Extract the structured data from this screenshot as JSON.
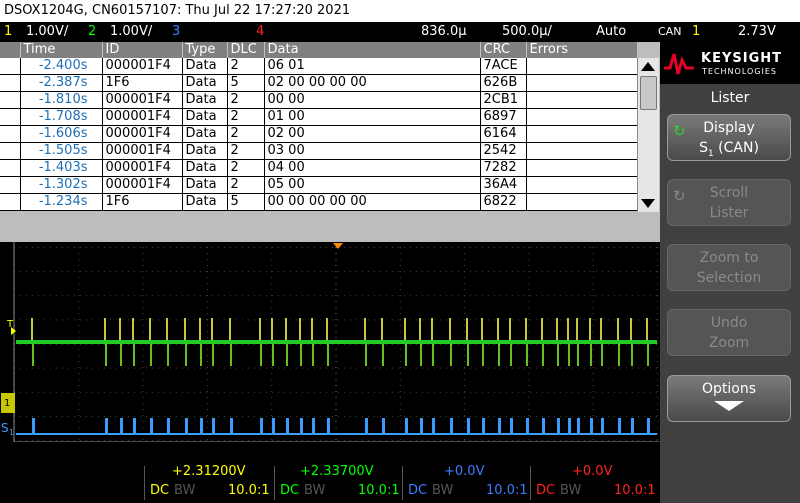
{
  "title": "DSOX1204G, CN60157107: Thu Jul 22 17:27:20 2021",
  "channels": {
    "ch1": {
      "num": "1",
      "scale": "1.00V/",
      "color": "#ffff00"
    },
    "ch2": {
      "num": "2",
      "scale": "1.00V/",
      "color": "#00ff00"
    },
    "ch3": {
      "num": "3",
      "color": "#3b7bff"
    },
    "ch4": {
      "num": "4",
      "color": "#ff2020"
    }
  },
  "timebase": {
    "delay": "836.0µ",
    "scale": "500.0µ/",
    "mode": "Auto"
  },
  "trigger": {
    "type": "CAN",
    "channel": "1",
    "level": "2.73V"
  },
  "lister": {
    "columns": [
      "Time",
      "ID",
      "Type",
      "DLC",
      "Data",
      "CRC",
      "Errors"
    ],
    "rows": [
      {
        "time": "-2.400s",
        "id": "000001F4",
        "type": "Data",
        "dlc": "2",
        "data": "06  01",
        "crc": "7ACE",
        "errors": ""
      },
      {
        "time": "-2.387s",
        "id": "1F6",
        "type": "Data",
        "dlc": "5",
        "data": "02  00  00  00  00",
        "crc": "626B",
        "errors": ""
      },
      {
        "time": "-1.810s",
        "id": "000001F4",
        "type": "Data",
        "dlc": "2",
        "data": "00  00",
        "crc": "2CB1",
        "errors": ""
      },
      {
        "time": "-1.708s",
        "id": "000001F4",
        "type": "Data",
        "dlc": "2",
        "data": "01  00",
        "crc": "6897",
        "errors": ""
      },
      {
        "time": "-1.606s",
        "id": "000001F4",
        "type": "Data",
        "dlc": "2",
        "data": "02  00",
        "crc": "6164",
        "errors": ""
      },
      {
        "time": "-1.505s",
        "id": "000001F4",
        "type": "Data",
        "dlc": "2",
        "data": "03  00",
        "crc": "2542",
        "errors": ""
      },
      {
        "time": "-1.403s",
        "id": "000001F4",
        "type": "Data",
        "dlc": "2",
        "data": "04  00",
        "crc": "7282",
        "errors": ""
      },
      {
        "time": "-1.302s",
        "id": "000001F4",
        "type": "Data",
        "dlc": "2",
        "data": "05  00",
        "crc": "36A4",
        "errors": ""
      },
      {
        "time": "-1.234s",
        "id": "1F6",
        "type": "Data",
        "dlc": "5",
        "data": "00  00  00  00  00",
        "crc": "6822",
        "errors": ""
      }
    ]
  },
  "waveform": {
    "trigger_marker": "T",
    "serial_label": "S",
    "serial_sub": "1",
    "ground_label": "1"
  },
  "measurements": [
    {
      "value": "+2.31200V",
      "coupling": "DC",
      "bw": "BW",
      "probe": "10.0:1",
      "color": "#ffff00"
    },
    {
      "value": "+2.33700V",
      "coupling": "DC",
      "bw": "BW",
      "probe": "10.0:1",
      "color": "#00ff00"
    },
    {
      "value": "+0.0V",
      "coupling": "DC",
      "bw": "BW",
      "probe": "10.0:1",
      "color": "#3b7bff"
    },
    {
      "value": "+0.0V",
      "coupling": "DC",
      "bw": "BW",
      "probe": "10.0:1",
      "color": "#ff2020"
    }
  ],
  "brand": {
    "name": "KEYSIGHT",
    "sub": "TECHNOLOGIES"
  },
  "softkeys": {
    "menu_title": "Lister",
    "display": {
      "line1": "Display",
      "line2a": "S",
      "line2sub": "1",
      "line2b": " (CAN)"
    },
    "scroll": {
      "line1": "Scroll",
      "line2": "Lister"
    },
    "zoom": {
      "line1": "Zoom to",
      "line2": "Selection"
    },
    "undo": {
      "line1": "Undo",
      "line2": "Zoom"
    },
    "options": {
      "line1": "Options"
    }
  },
  "icons": {
    "display_icon": "refresh-icon",
    "scroll_icon": "refresh-icon",
    "options_icon": "arrow-down-icon"
  }
}
